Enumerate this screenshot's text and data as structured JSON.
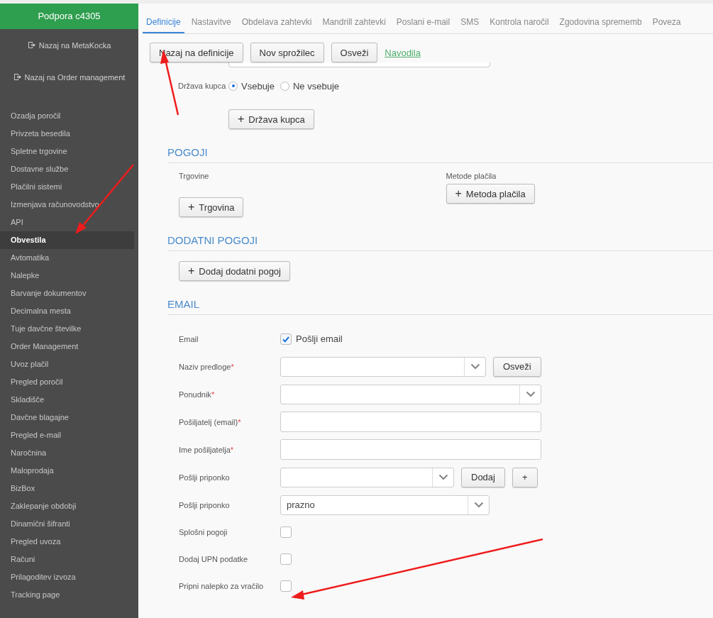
{
  "sidebar": {
    "title": "Podpora c4305",
    "links": [
      {
        "label": "Nazaj na MetaKocka"
      },
      {
        "label": "Nazaj na Order management"
      }
    ],
    "items": [
      {
        "label": "Ozadja poročil",
        "selected": false
      },
      {
        "label": "Privzeta besedila",
        "selected": false
      },
      {
        "label": "Spletne trgovine",
        "selected": false
      },
      {
        "label": "Dostavne službe",
        "selected": false
      },
      {
        "label": "Plačilni sistemi",
        "selected": false
      },
      {
        "label": "Izmenjava računovodstvo",
        "selected": false
      },
      {
        "label": "API",
        "selected": false
      },
      {
        "label": "Obvestila",
        "selected": true
      },
      {
        "label": "Avtomatika",
        "selected": false
      },
      {
        "label": "Nalepke",
        "selected": false
      },
      {
        "label": "Barvanje dokumentov",
        "selected": false
      },
      {
        "label": "Decimalna mesta",
        "selected": false
      },
      {
        "label": "Tuje davčne številke",
        "selected": false
      },
      {
        "label": "Order Management",
        "selected": false
      },
      {
        "label": "Uvoz plačil",
        "selected": false
      },
      {
        "label": "Pregled poročil",
        "selected": false
      },
      {
        "label": "Skladišče",
        "selected": false
      },
      {
        "label": "Davčne blagajne",
        "selected": false
      },
      {
        "label": "Pregled e-mail",
        "selected": false
      },
      {
        "label": "Naročnina",
        "selected": false
      },
      {
        "label": "Maloprodaja",
        "selected": false
      },
      {
        "label": "BizBox",
        "selected": false
      },
      {
        "label": "Zaklepanje obdobji",
        "selected": false
      },
      {
        "label": "Dinamični šifranti",
        "selected": false
      },
      {
        "label": "Pregled uvoza",
        "selected": false
      },
      {
        "label": "Računi",
        "selected": false
      },
      {
        "label": "Prilagoditev izvoza",
        "selected": false
      },
      {
        "label": "Tracking page",
        "selected": false
      }
    ]
  },
  "tabs": [
    {
      "label": "Definicije",
      "selected": true
    },
    {
      "label": "Nastavitve",
      "selected": false
    },
    {
      "label": "Obdelava zahtevki",
      "selected": false
    },
    {
      "label": "Mandrill zahtevki",
      "selected": false
    },
    {
      "label": "Poslani e-mail",
      "selected": false
    },
    {
      "label": "SMS",
      "selected": false
    },
    {
      "label": "Kontrola naročil",
      "selected": false
    },
    {
      "label": "Zgodovina sprememb",
      "selected": false
    },
    {
      "label": "Poveza",
      "selected": false
    }
  ],
  "toolbar": {
    "buttons": [
      "Nazaj na definicije",
      "Nov sprožilec",
      "Osveži"
    ],
    "link": "Navodila"
  },
  "country": {
    "label": "Država kupca",
    "options": [
      {
        "label": "Vsebuje",
        "selected": true
      },
      {
        "label": "Ne vsebuje",
        "selected": false
      }
    ],
    "add_button": "Država kupca",
    "plus": "+"
  },
  "conditions": {
    "heading": "POGOJI",
    "stores_label": "Trgovine",
    "stores_button": "Trgovina",
    "payments_label": "Metode plačila",
    "payments_button": "Metoda plačila",
    "plus": "+"
  },
  "extra": {
    "heading": "DODATNI POGOJI",
    "button": "Dodaj dodatni pogoj",
    "plus": "+"
  },
  "email": {
    "heading": "EMAIL",
    "rows": [
      {
        "kind": "checkbox",
        "label": "Email",
        "required": false,
        "checked": true,
        "option_label": "Pošlji email"
      },
      {
        "kind": "select",
        "label": "Naziv predloge",
        "required": true,
        "buttons": [
          "Osveži"
        ]
      },
      {
        "kind": "select",
        "label": "Ponudnik",
        "required": true
      },
      {
        "kind": "input",
        "label": "Pošiljatelj (email)",
        "required": true
      },
      {
        "kind": "input",
        "label": "Ime pošiljatelja",
        "required": true
      },
      {
        "kind": "select",
        "label": "Pošlji priponko",
        "required": false,
        "buttons": [
          "Dodaj",
          "+"
        ]
      },
      {
        "kind": "select",
        "label": "Pošlji priponko",
        "required": false,
        "value": "prazno"
      },
      {
        "kind": "checkbox",
        "label": "Splošni pogoji",
        "required": false,
        "checked": false
      },
      {
        "kind": "checkbox",
        "label": "Dodaj UPN podatke",
        "required": false,
        "checked": false
      },
      {
        "kind": "checkbox",
        "label": "Pripni nalepko za vračilo",
        "required": false,
        "checked": false
      }
    ],
    "required_mark": "*"
  }
}
